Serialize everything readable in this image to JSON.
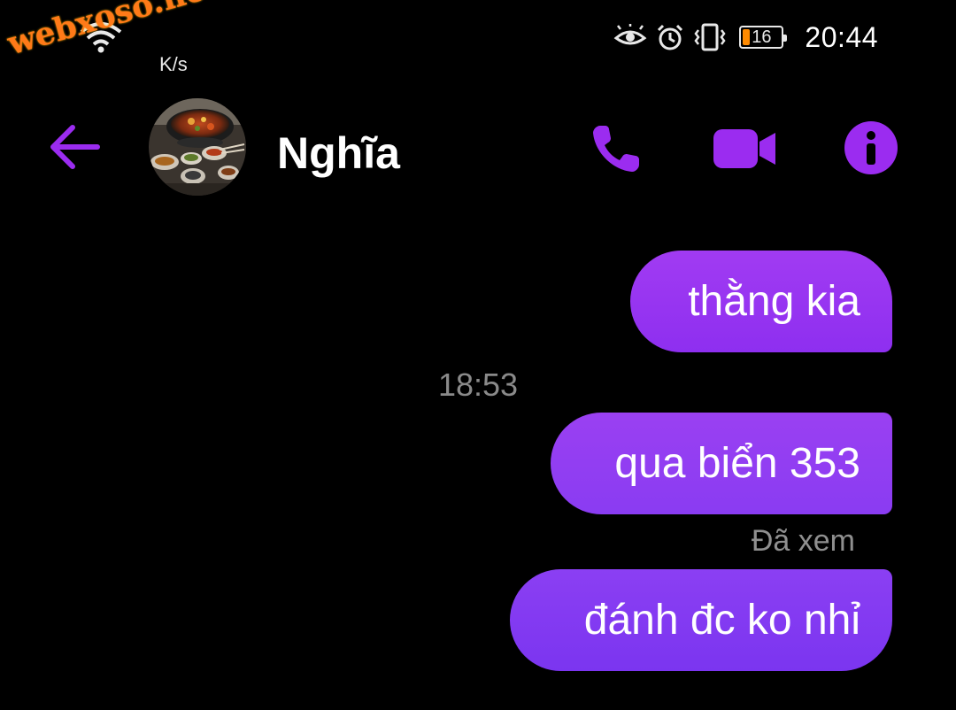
{
  "watermark": {
    "text": "webxoso.net"
  },
  "status_bar": {
    "net_speed_unit": "K/s",
    "battery_level": "16",
    "time": "20:44",
    "icons": [
      "wifi-icon",
      "eye-icon",
      "alarm-icon",
      "vibrate-icon",
      "battery-icon"
    ]
  },
  "header": {
    "contact_name": "Nghĩa",
    "accent_color": "#9b2cf0",
    "icons": [
      "back-arrow-icon",
      "avatar",
      "phone-icon",
      "video-camera-icon",
      "info-icon"
    ]
  },
  "messages": [
    {
      "text": "thằng kia",
      "sender": "me"
    },
    {
      "text": "qua biển 353",
      "sender": "me"
    },
    {
      "text": "đánh đc ko nhỉ",
      "sender": "me"
    }
  ],
  "timestamp": "18:53",
  "seen_label": "Đã xem",
  "colors": {
    "background": "#000000",
    "bubble_top": "#a13bf2",
    "bubble_bottom": "#7b35f0",
    "muted_text": "#8a8a8a"
  }
}
